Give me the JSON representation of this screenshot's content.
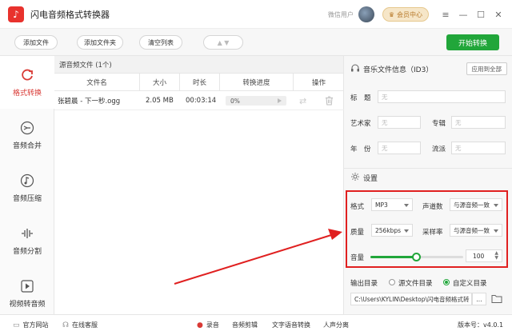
{
  "app": {
    "title": "闪电音频格式转换器",
    "wechat_user": "微信用户",
    "vip_label": "会员中心"
  },
  "toolbar": {
    "add_file": "添加文件",
    "add_folder": "添加文件夹",
    "clear_list": "清空列表",
    "start": "开始转换"
  },
  "nav": {
    "items": [
      {
        "label": "格式转换"
      },
      {
        "label": "音频合并"
      },
      {
        "label": "音频压缩"
      },
      {
        "label": "音频分割"
      },
      {
        "label": "视频转音频"
      }
    ]
  },
  "filelist": {
    "header": "源音频文件 (1个)",
    "columns": [
      "文件名",
      "大小",
      "时长",
      "转换进度",
      "操作"
    ],
    "rows": [
      {
        "name": "张碧晨 - 下一秒.ogg",
        "size": "2.05 MB",
        "duration": "00:03:14",
        "progress": "0%"
      }
    ]
  },
  "id3": {
    "title": "音乐文件信息（ID3）",
    "apply_all": "应用到全部",
    "fields": {
      "title_label": "标　题",
      "artist_label": "艺术家",
      "album_label": "专辑",
      "year_label": "年　份",
      "genre_label": "流派",
      "empty": "无"
    }
  },
  "settings": {
    "title": "设置",
    "format_label": "格式",
    "format_value": "MP3",
    "channels_label": "声道数",
    "channels_value": "与源音频一致",
    "quality_label": "质量",
    "quality_value": "256kbps",
    "samplerate_label": "采样率",
    "samplerate_value": "与源音频一致",
    "volume_label": "音量",
    "volume_value": "100",
    "volume_fraction": 0.5
  },
  "output": {
    "label": "输出目录",
    "opt_source": "源文件目录",
    "opt_custom": "自定义目录",
    "path": "C:\\Users\\KYLIN\\Desktop\\闪电音频格式转",
    "more": "..."
  },
  "statusbar": {
    "website": "官方网站",
    "service": "在线客服",
    "record": "录音",
    "audio_edit": "音频剪辑",
    "speech": "文字语音转换",
    "vocal": "人声分离",
    "version": "版本号：v4.0.1"
  },
  "colors": {
    "accent_red": "#d93a35",
    "start_green": "#21a63a",
    "highlight_red": "#e02020"
  }
}
